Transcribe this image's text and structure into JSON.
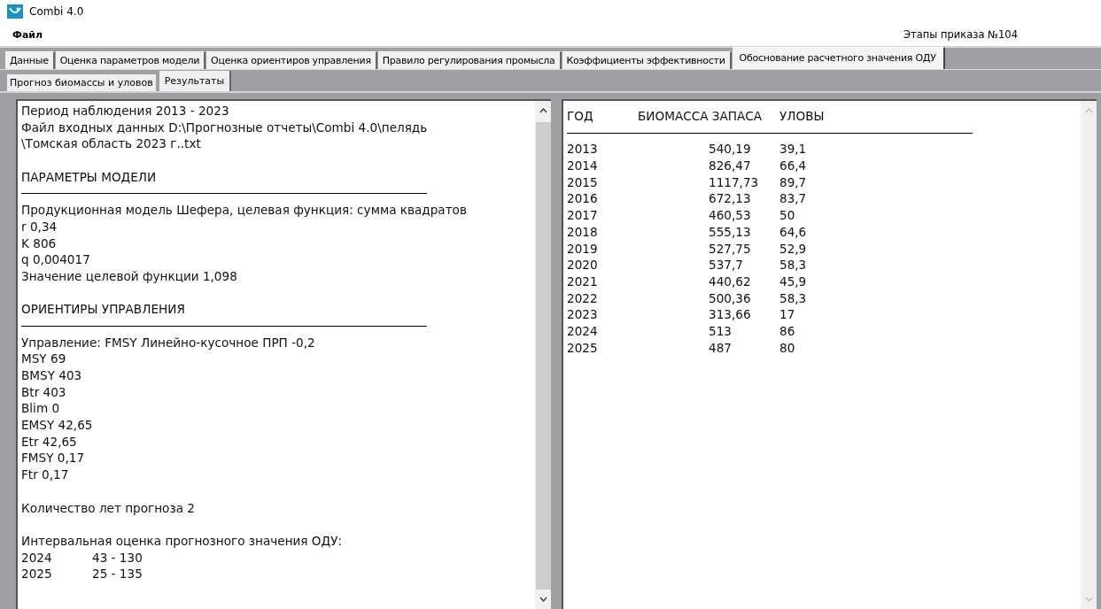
{
  "window": {
    "title": "Combi 4.0"
  },
  "menu": {
    "items": [
      "Файл"
    ],
    "right_label": "Этапы приказа №104"
  },
  "tabs": [
    {
      "label": "Данные",
      "selected": false
    },
    {
      "label": "Оценка параметров модели",
      "selected": false
    },
    {
      "label": "Оценка ориентиров управления",
      "selected": false
    },
    {
      "label": "Правило регулирования промысла",
      "selected": false
    },
    {
      "label": "Коэффициенты эффективности",
      "selected": false
    },
    {
      "label": "Обоснование расчетного значения ОДУ",
      "selected": true
    }
  ],
  "subtabs": [
    {
      "label": "Прогноз биомассы и уловов",
      "selected": false
    },
    {
      "label": "Результаты",
      "selected": true
    }
  ],
  "report": {
    "lines": [
      {
        "kind": "text",
        "text": "Период наблюдения  2013 - 2023"
      },
      {
        "kind": "text",
        "text": "Файл входных данных  D:\\Прогнозные отчеты\\Combi 4.0\\пелядь"
      },
      {
        "kind": "text",
        "text": "\\Томская область 2023 г..txt"
      },
      {
        "kind": "blank"
      },
      {
        "kind": "text",
        "text": "ПАРАМЕТРЫ МОДЕЛИ"
      },
      {
        "kind": "rule"
      },
      {
        "kind": "text",
        "text": "Продукционная модель Шефера, целевая функция: сумма квадратов"
      },
      {
        "kind": "text",
        "text": "r  0,34"
      },
      {
        "kind": "text",
        "text": "K  806"
      },
      {
        "kind": "text",
        "text": "q  0,004017"
      },
      {
        "kind": "text",
        "text": "Значение целевой функции  1,098"
      },
      {
        "kind": "blank"
      },
      {
        "kind": "text",
        "text": "ОРИЕНТИРЫ УПРАВЛЕНИЯ"
      },
      {
        "kind": "rule"
      },
      {
        "kind": "text",
        "text": "Управление: FMSY Линейно-кусочное ПРП -0,2"
      },
      {
        "kind": "text",
        "text": "MSY  69"
      },
      {
        "kind": "text",
        "text": "BMSY  403"
      },
      {
        "kind": "text",
        "text": "Btr  403"
      },
      {
        "kind": "text",
        "text": "Blim  0"
      },
      {
        "kind": "text",
        "text": "EMSY  42,65"
      },
      {
        "kind": "text",
        "text": "Etr  42,65"
      },
      {
        "kind": "text",
        "text": "FMSY  0,17"
      },
      {
        "kind": "text",
        "text": "Ftr  0,17"
      },
      {
        "kind": "blank"
      },
      {
        "kind": "text",
        "text": "Количество лет прогноза  2"
      },
      {
        "kind": "blank"
      },
      {
        "kind": "text",
        "text": "Интервальная оценка прогнозного значения ОДУ:"
      },
      {
        "kind": "pair",
        "cells": [
          "2024",
          "43 - 130"
        ]
      },
      {
        "kind": "pair",
        "cells": [
          "2025",
          "25 - 135"
        ]
      }
    ]
  },
  "table": {
    "columns": [
      "ГОД",
      "БИОМАССА ЗАПАСА",
      "УЛОВЫ"
    ],
    "rows": [
      [
        "2013",
        "540,19",
        "39,1"
      ],
      [
        "2014",
        "826,47",
        "66,4"
      ],
      [
        "2015",
        "1117,73",
        "89,7"
      ],
      [
        "2016",
        "672,13",
        "83,7"
      ],
      [
        "2017",
        "460,53",
        "50"
      ],
      [
        "2018",
        "555,13",
        "64,6"
      ],
      [
        "2019",
        "527,75",
        "52,9"
      ],
      [
        "2020",
        "537,7",
        "58,3"
      ],
      [
        "2021",
        "440,62",
        "45,9"
      ],
      [
        "2022",
        "500,36",
        "58,3"
      ],
      [
        "2023",
        "313,66",
        "17"
      ],
      [
        "2024",
        "513",
        "86"
      ],
      [
        "2025",
        "487",
        "80"
      ]
    ]
  }
}
